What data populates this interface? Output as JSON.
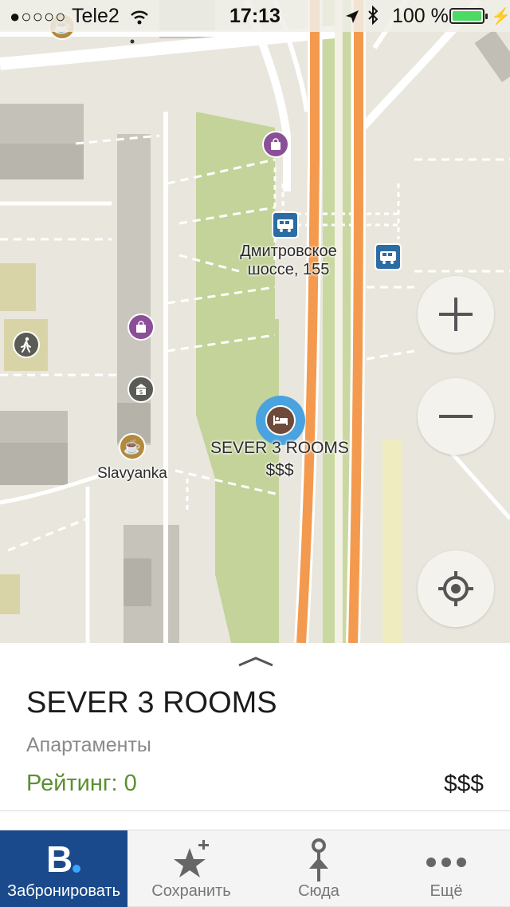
{
  "status_bar": {
    "signal": "●○○○○",
    "carrier": "Tele2",
    "time": "17:13",
    "battery": "100 %"
  },
  "map": {
    "labels": {
      "street": "Дмитровское шоссе, 155",
      "hotel_name": "SEVER 3 ROOMS",
      "hotel_price": "$$$",
      "place": "Slavyanka"
    },
    "icons": [
      "cafe-icon",
      "shopping-bag-icon",
      "bus-stop-icon",
      "pedestrian-icon",
      "bank-icon",
      "hotel-bed-icon",
      "zoom-in-icon",
      "zoom-out-icon",
      "my-location-icon"
    ]
  },
  "place_card": {
    "title": "SEVER 3 ROOMS",
    "type": "Апартаменты",
    "rating": "Рейтинг: 0",
    "price": "$$$"
  },
  "tabs": [
    {
      "label": "Забронировать",
      "icon": "booking-logo-icon",
      "active": true
    },
    {
      "label": "Сохранить",
      "icon": "star-plus-icon"
    },
    {
      "label": "Сюда",
      "icon": "route-to-icon"
    },
    {
      "label": "Ещё",
      "icon": "more-icon"
    }
  ],
  "colors": {
    "accent": "#1a4a8b",
    "rating": "#5a9030",
    "road": "#f39a4f",
    "park": "#bdcf8f",
    "bus": "#2b6ca5"
  }
}
